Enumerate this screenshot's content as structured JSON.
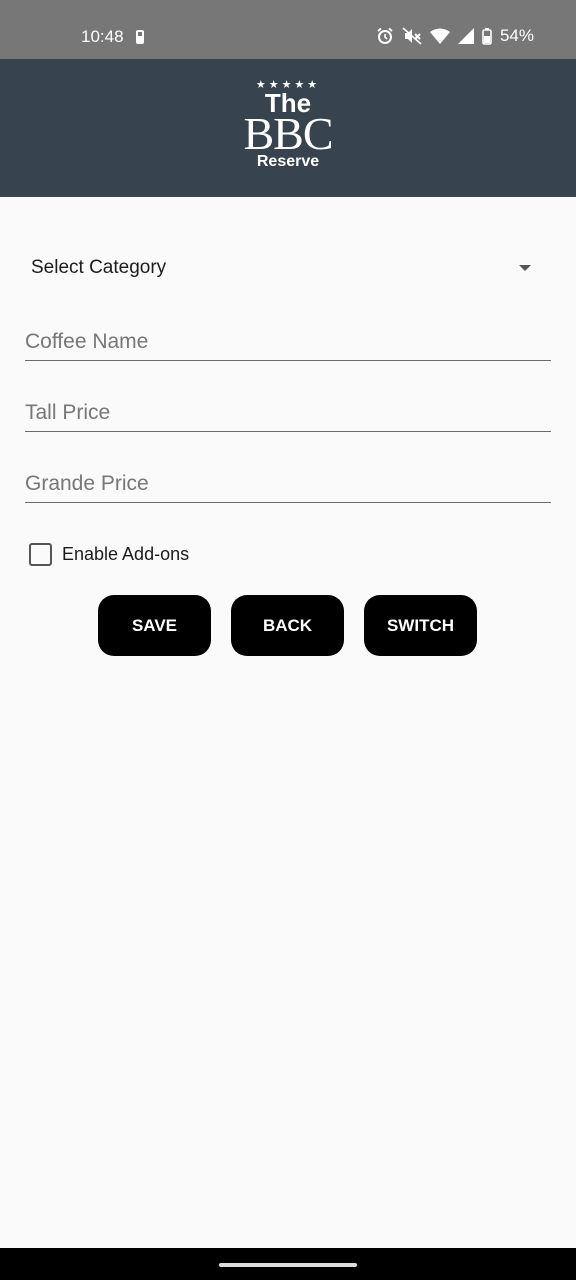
{
  "status_bar": {
    "time": "10:48",
    "battery_percent": "54%",
    "icons": [
      "battery-saver-icon",
      "alarm-icon",
      "mute-icon",
      "wifi-icon",
      "signal-icon",
      "battery-icon"
    ]
  },
  "header": {
    "logo": {
      "stars": "★★★★★",
      "line1": "The",
      "line2": "BBC",
      "line3": "Reserve"
    },
    "background_color": "#37444f"
  },
  "form": {
    "category_select": {
      "selected": "Select Category"
    },
    "coffee_name": {
      "value": "",
      "placeholder": "Coffee Name"
    },
    "tall_price": {
      "value": "",
      "placeholder": "Tall Price"
    },
    "grande_price": {
      "value": "",
      "placeholder": "Grande Price"
    },
    "addons_checkbox": {
      "label": "Enable Add-ons",
      "checked": false
    }
  },
  "buttons": {
    "save": "SAVE",
    "back": "BACK",
    "switch": "SWITCH"
  }
}
